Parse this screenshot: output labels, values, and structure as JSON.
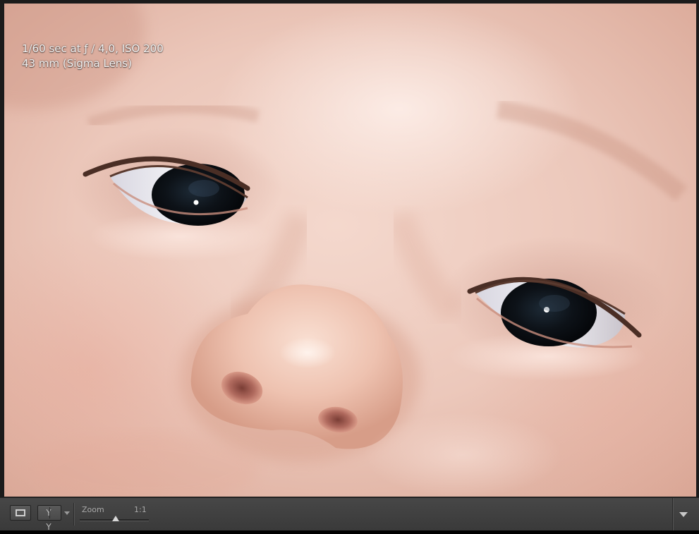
{
  "photo": {
    "subject": "baby-face-closeup",
    "exposure_info": "1/60 sec at ƒ / 4,0, ISO 200",
    "lens_info": "43 mm (Sigma Lens)"
  },
  "toolbar": {
    "view_loupe_icon": "loupe-view-icon",
    "view_compare_label": "Y|Y",
    "compare_left": "Y",
    "compare_right": "Y",
    "zoom_label": "Zoom",
    "zoom_value": "1:1",
    "zoom_slider_position": 0.52,
    "menu_icon": "chevron-down-icon"
  },
  "colors": {
    "toolbar_bg": "#404040",
    "frame_bg": "#1b1b1b",
    "overlay_text": "#f2f2f2",
    "toolbar_text": "#a8a8a8"
  }
}
